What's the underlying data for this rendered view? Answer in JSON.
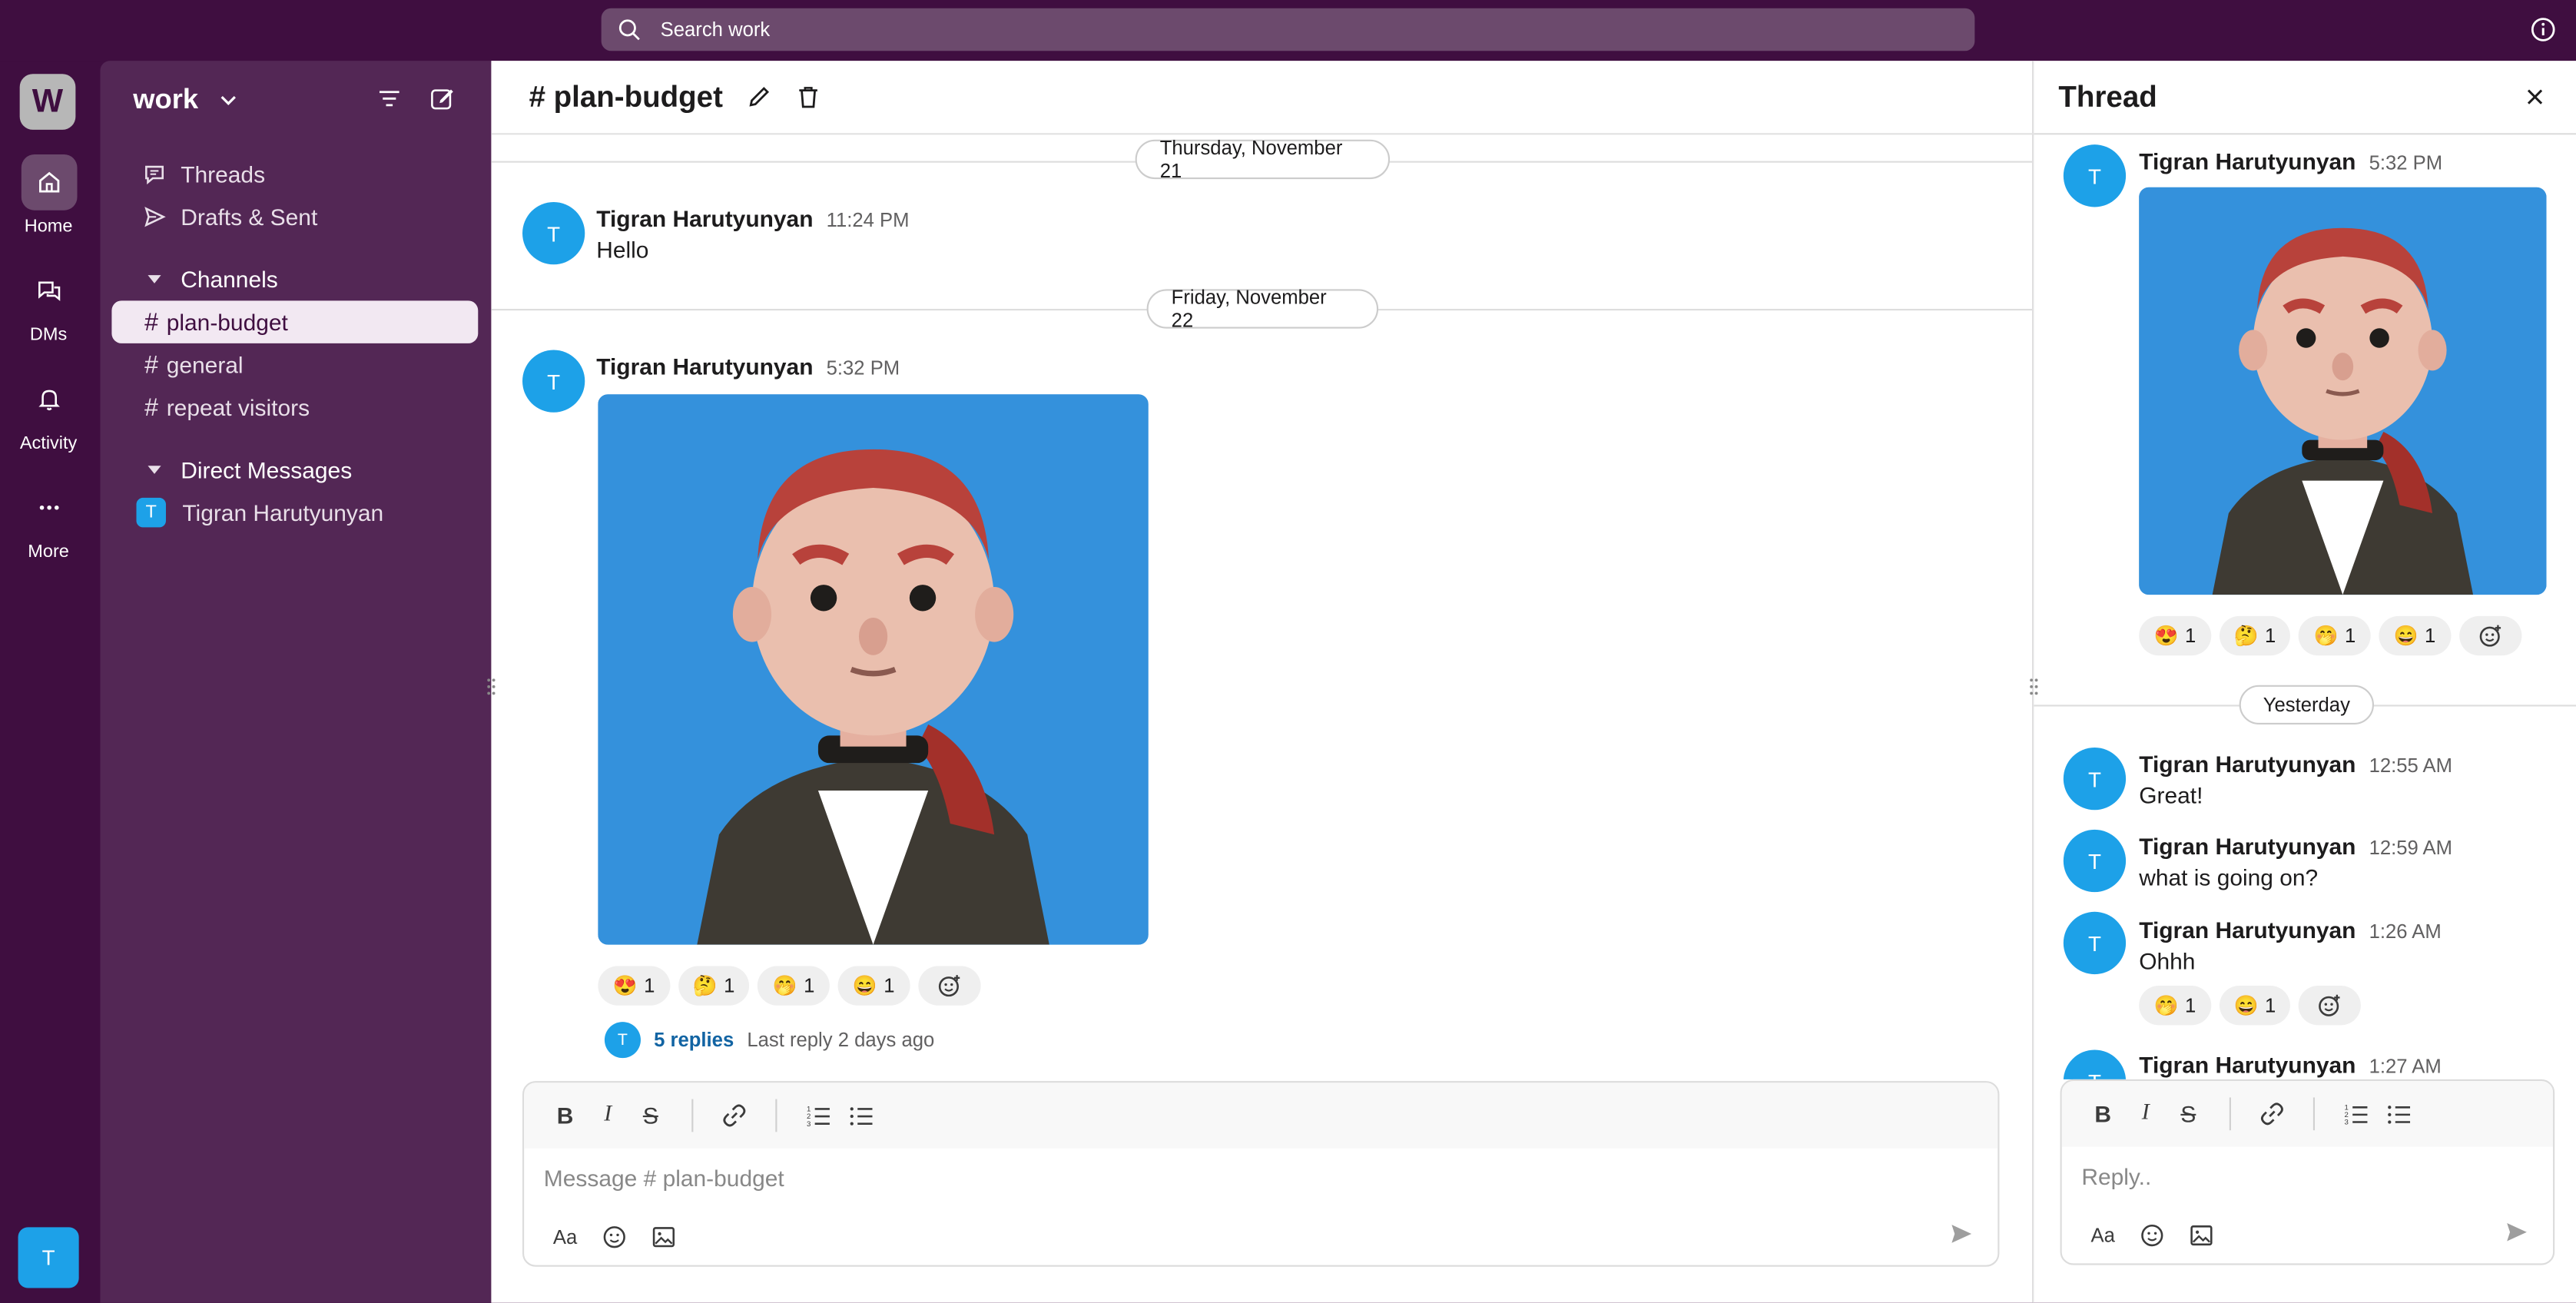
{
  "search": {
    "placeholder": "Search work"
  },
  "rail": {
    "workspace_initial": "W",
    "items": [
      {
        "label": "Home",
        "icon": "home-icon"
      },
      {
        "label": "DMs",
        "icon": "dm-icon"
      },
      {
        "label": "Activity",
        "icon": "bell-icon"
      },
      {
        "label": "More",
        "icon": "more-icon"
      }
    ],
    "user_initial": "T"
  },
  "sidebar": {
    "workspace": "work",
    "nav": [
      {
        "label": "Threads",
        "icon": "threads-icon"
      },
      {
        "label": "Drafts & Sent",
        "icon": "send-icon"
      }
    ],
    "channels_label": "Channels",
    "channels": [
      {
        "name": "plan-budget",
        "active": true
      },
      {
        "name": "general",
        "active": false
      },
      {
        "name": "repeat visitors",
        "active": false
      }
    ],
    "dm_label": "Direct Messages",
    "dms": [
      {
        "name": "Tigran Harutyunyan",
        "initial": "T"
      }
    ]
  },
  "channel": {
    "title": "# plan-budget",
    "date1": "Thursday, November 21",
    "date2": "Friday, November 22",
    "messages": [
      {
        "initial": "T",
        "author": "Tigran Harutyunyan",
        "time": "11:24 PM",
        "text": "Hello"
      },
      {
        "initial": "T",
        "author": "Tigran Harutyunyan",
        "time": "5:32 PM",
        "text": ""
      }
    ],
    "reactions": [
      {
        "emoji": "😍",
        "count": "1"
      },
      {
        "emoji": "🤔",
        "count": "1"
      },
      {
        "emoji": "🤭",
        "count": "1"
      },
      {
        "emoji": "😄",
        "count": "1"
      }
    ],
    "replies": {
      "initial": "T",
      "count": "5 replies",
      "last": "Last reply 2 days ago"
    },
    "composer_placeholder": "Message # plan-budget"
  },
  "thread": {
    "title": "Thread",
    "root": {
      "initial": "T",
      "author": "Tigran Harutyunyan",
      "time": "5:32 PM"
    },
    "root_reactions": [
      {
        "emoji": "😍",
        "count": "1"
      },
      {
        "emoji": "🤔",
        "count": "1"
      },
      {
        "emoji": "🤭",
        "count": "1"
      },
      {
        "emoji": "😄",
        "count": "1"
      }
    ],
    "date": "Yesterday",
    "replies": [
      {
        "initial": "T",
        "author": "Tigran Harutyunyan",
        "time": "12:55 AM",
        "text": "Great!"
      },
      {
        "initial": "T",
        "author": "Tigran Harutyunyan",
        "time": "12:59 AM",
        "text": "what is going on?"
      },
      {
        "initial": "T",
        "author": "Tigran Harutyunyan",
        "time": "1:26 AM",
        "text": "Ohhh"
      },
      {
        "initial": "T",
        "author": "Tigran Harutyunyan",
        "time": "1:27 AM",
        "text": ""
      }
    ],
    "reply_reactions": [
      {
        "emoji": "🤭",
        "count": "1"
      },
      {
        "emoji": "😄",
        "count": "1"
      }
    ],
    "composer_placeholder": "Reply.."
  },
  "colors": {
    "aubergine": "#3f0e40",
    "sidebar": "#532755",
    "avatar": "#1da1e8",
    "link": "#1264a3",
    "image_bg": "#3491dc"
  }
}
